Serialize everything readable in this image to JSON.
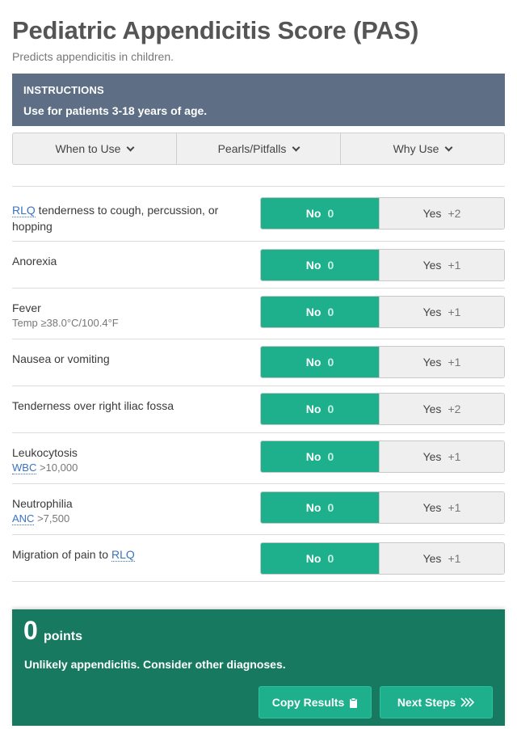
{
  "header": {
    "title": "Pediatric Appendicitis Score (PAS)",
    "subtitle": "Predicts appendicitis in children."
  },
  "instructions": {
    "heading": "INSTRUCTIONS",
    "text": "Use for patients 3-18 years of age."
  },
  "tabs": [
    {
      "label": "When to Use"
    },
    {
      "label": "Pearls/Pitfalls"
    },
    {
      "label": "Why Use"
    }
  ],
  "criteria": [
    {
      "abbr": "RLQ",
      "label": " tenderness to cough, percussion, or hopping",
      "no_label": "No",
      "no_points": "0",
      "yes_label": "Yes",
      "yes_points": "+2",
      "selected": "No"
    },
    {
      "label": "Anorexia",
      "no_label": "No",
      "no_points": "0",
      "yes_label": "Yes",
      "yes_points": "+1",
      "selected": "No"
    },
    {
      "label": "Fever",
      "sub": "Temp ≥38.0°C/100.4°F",
      "no_label": "No",
      "no_points": "0",
      "yes_label": "Yes",
      "yes_points": "+1",
      "selected": "No"
    },
    {
      "label": "Nausea or vomiting",
      "no_label": "No",
      "no_points": "0",
      "yes_label": "Yes",
      "yes_points": "+1",
      "selected": "No"
    },
    {
      "label": "Tenderness over right iliac fossa",
      "no_label": "No",
      "no_points": "0",
      "yes_label": "Yes",
      "yes_points": "+2",
      "selected": "No"
    },
    {
      "label": "Leukocytosis",
      "sub_abbr": "WBC",
      "sub": " >10,000",
      "no_label": "No",
      "no_points": "0",
      "yes_label": "Yes",
      "yes_points": "+1",
      "selected": "No"
    },
    {
      "label": "Neutrophilia",
      "sub_abbr": "ANC",
      "sub": " >7,500",
      "no_label": "No",
      "no_points": "0",
      "yes_label": "Yes",
      "yes_points": "+1",
      "selected": "No"
    },
    {
      "label": "Migration of pain to ",
      "label_abbr_after": "RLQ",
      "no_label": "No",
      "no_points": "0",
      "yes_label": "Yes",
      "yes_points": "+1",
      "selected": "No"
    }
  ],
  "result": {
    "score": "0",
    "unit": "points",
    "interpretation": "Unlikely appendicitis. Consider other diagnoses."
  },
  "buttons": {
    "copy": "Copy Results",
    "next": "Next Steps"
  },
  "icons": {
    "tab_chevron": "chevron-down-icon",
    "copy": "clipboard-icon",
    "next": "chevrons-right-icon"
  },
  "colors": {
    "selected_green": "#1eaf8c",
    "result_bg": "#177a60",
    "instructions_bg": "#5d6e85",
    "link_blue": "#3a73c0"
  }
}
